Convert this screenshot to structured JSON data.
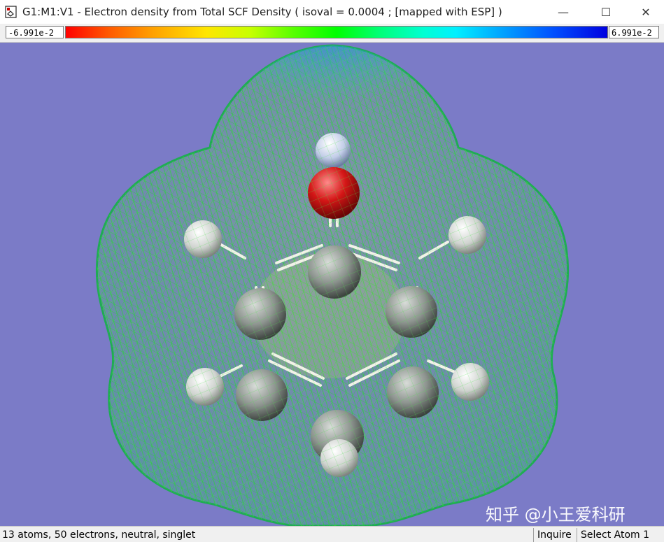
{
  "window": {
    "title": "G1:M1:V1 - Electron density from Total SCF Density ( isoval = 0.0004 ; [mapped with ESP] )",
    "minimize_glyph": "—",
    "maximize_glyph": "☐",
    "close_glyph": "✕"
  },
  "colorbar": {
    "min_label": "-6.991e-2",
    "max_label": "6.991e-2",
    "colors": [
      "#ff0000",
      "#ffe600",
      "#00ff00",
      "#00f0ff",
      "#0000e0"
    ]
  },
  "viewport": {
    "background": "#7b7bc7",
    "molecule": {
      "atoms": [
        {
          "element": "O",
          "color": "#cc1a1a"
        },
        {
          "element": "H",
          "color": "#dfe6f5"
        },
        {
          "element": "C",
          "color": "#9aa6a0"
        },
        {
          "element": "C",
          "color": "#9aa6a0"
        },
        {
          "element": "C",
          "color": "#9aa6a0"
        },
        {
          "element": "C",
          "color": "#9aa6a0"
        },
        {
          "element": "C",
          "color": "#9aa6a0"
        },
        {
          "element": "C",
          "color": "#9aa6a0"
        },
        {
          "element": "H",
          "color": "#d9dcd9"
        },
        {
          "element": "H",
          "color": "#d9dcd9"
        },
        {
          "element": "H",
          "color": "#d9dcd9"
        },
        {
          "element": "H",
          "color": "#d9dcd9"
        },
        {
          "element": "H",
          "color": "#d9dcd9"
        }
      ]
    }
  },
  "status": {
    "summary": "13 atoms, 50 electrons, neutral, singlet",
    "mode": "Inquire",
    "prompt": "Select Atom 1"
  },
  "watermark": {
    "text": "知乎 @小王爱科研"
  }
}
